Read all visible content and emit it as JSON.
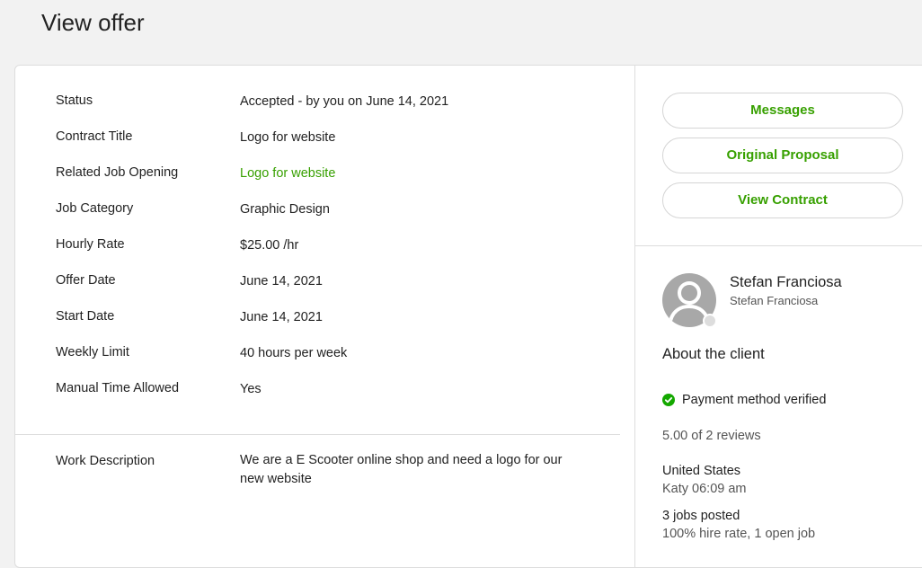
{
  "page": {
    "title": "View offer"
  },
  "details": [
    {
      "label": "Status",
      "value": "Accepted - by you on June 14, 2021"
    },
    {
      "label": "Contract Title",
      "value": "Logo for website"
    },
    {
      "label": "Related Job Opening",
      "value": "Logo for website",
      "is_link": true
    },
    {
      "label": "Job Category",
      "value": "Graphic Design"
    },
    {
      "label": "Hourly Rate",
      "value": "$25.00 /hr"
    },
    {
      "label": "Offer Date",
      "value": "June 14, 2021"
    },
    {
      "label": "Start Date",
      "value": "June 14, 2021"
    },
    {
      "label": "Weekly Limit",
      "value": "40 hours per week"
    },
    {
      "label": "Manual Time Allowed",
      "value": "Yes"
    }
  ],
  "work_description": {
    "label": "Work Description",
    "value": "We are a E Scooter online shop and need a logo for our new website"
  },
  "actions": {
    "messages": "Messages",
    "original_proposal": "Original Proposal",
    "view_contract": "View Contract"
  },
  "client": {
    "name": "Stefan Franciosa",
    "subtitle": "Stefan Franciosa",
    "about_title": "About the client",
    "payment_verified": "Payment method verified",
    "reviews": "5.00 of 2 reviews",
    "country": "United States",
    "local_time": "Katy 06:09 am",
    "jobs_posted": "3 jobs posted",
    "hire_rate": "100% hire rate, 1 open job"
  },
  "icons": {
    "avatar": "user-avatar-icon",
    "status_dot": "offline-status-dot-icon",
    "verified": "check-circle-icon"
  },
  "colors": {
    "accent": "#37a000",
    "verified": "#14a800",
    "background": "#f2f2f2",
    "border": "#dddddd"
  }
}
